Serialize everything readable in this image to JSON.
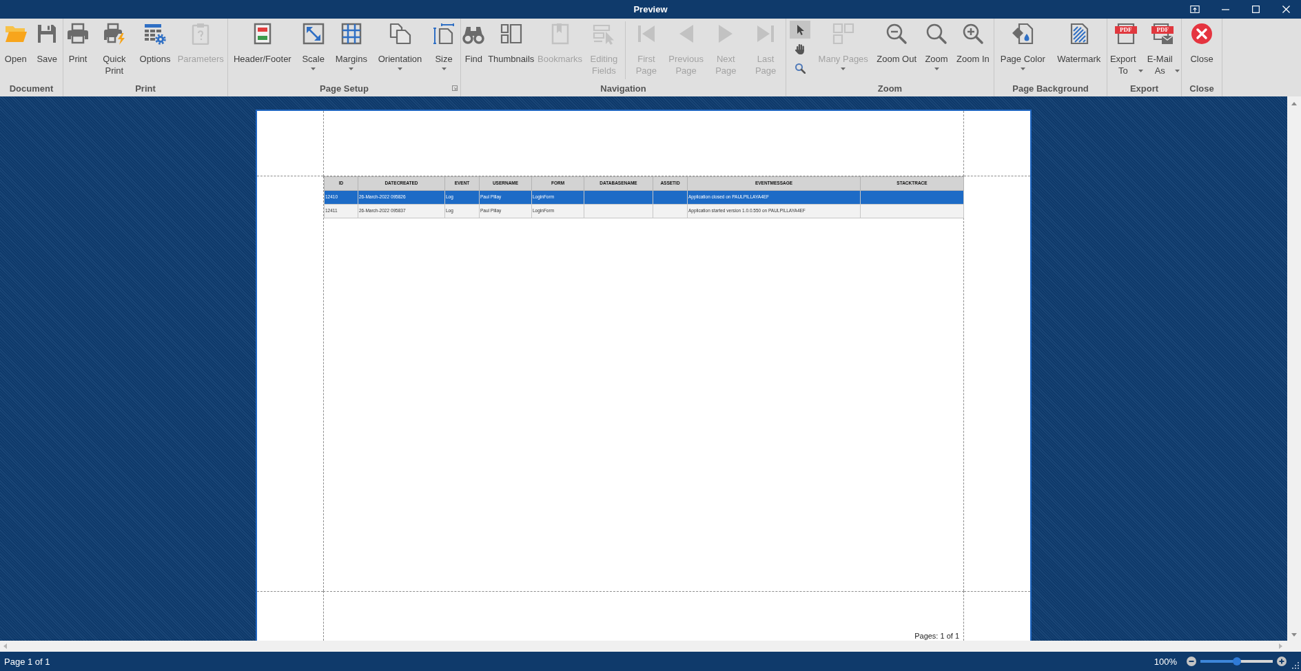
{
  "window": {
    "title": "Preview"
  },
  "ribbon": {
    "groups": [
      {
        "label": "Document",
        "dialog_launcher": false,
        "buttons": [
          {
            "label": "Open",
            "disabled": false,
            "dropdown": false
          },
          {
            "label": "Save",
            "disabled": false,
            "dropdown": false
          }
        ]
      },
      {
        "label": "Print",
        "dialog_launcher": false,
        "buttons": [
          {
            "label": "Print",
            "disabled": false,
            "dropdown": false
          },
          {
            "label": "Quick Print",
            "disabled": false,
            "dropdown": false
          },
          {
            "label": "Options",
            "disabled": false,
            "dropdown": false
          },
          {
            "label": "Parameters",
            "disabled": true,
            "dropdown": false
          }
        ]
      },
      {
        "label": "Page Setup",
        "dialog_launcher": true,
        "buttons": [
          {
            "label": "Header/Footer",
            "disabled": false,
            "dropdown": false
          },
          {
            "label": "Scale",
            "disabled": false,
            "dropdown": true
          },
          {
            "label": "Margins",
            "disabled": false,
            "dropdown": true
          },
          {
            "label": "Orientation",
            "disabled": false,
            "dropdown": true
          },
          {
            "label": "Size",
            "disabled": false,
            "dropdown": true
          }
        ]
      },
      {
        "label": "Navigation",
        "dialog_launcher": false,
        "buttons": [
          {
            "label": "Find",
            "disabled": false,
            "dropdown": false
          },
          {
            "label": "Thumbnails",
            "disabled": false,
            "dropdown": false
          },
          {
            "label": "Bookmarks",
            "disabled": true,
            "dropdown": false
          },
          {
            "label": "Editing Fields",
            "disabled": true,
            "dropdown": false
          },
          {
            "label": "First Page",
            "disabled": true,
            "dropdown": false
          },
          {
            "label": "Previous Page",
            "disabled": true,
            "dropdown": false
          },
          {
            "label": "Next Page",
            "disabled": true,
            "dropdown": false
          },
          {
            "label": "Last Page",
            "disabled": true,
            "dropdown": false
          }
        ]
      },
      {
        "label": "Zoom",
        "dialog_launcher": false,
        "tools": [
          {
            "selected": true
          },
          {
            "selected": false
          },
          {
            "selected": false
          }
        ],
        "buttons": [
          {
            "label": "Many Pages",
            "disabled": true,
            "dropdown": true
          },
          {
            "label": "Zoom Out",
            "disabled": false,
            "dropdown": false
          },
          {
            "label": "Zoom",
            "disabled": false,
            "dropdown": true
          },
          {
            "label": "Zoom In",
            "disabled": false,
            "dropdown": false
          }
        ]
      },
      {
        "label": "Page Background",
        "dialog_launcher": false,
        "buttons": [
          {
            "label": "Page Color",
            "disabled": false,
            "dropdown": true
          },
          {
            "label": "Watermark",
            "disabled": false,
            "dropdown": false
          }
        ]
      },
      {
        "label": "Export",
        "dialog_launcher": false,
        "buttons": [
          {
            "label": "Export To",
            "disabled": false,
            "dropdown": true,
            "badge": "PDF"
          },
          {
            "label": "E-Mail As",
            "disabled": false,
            "dropdown": true,
            "badge": "PDF"
          }
        ]
      },
      {
        "label": "Close",
        "dialog_launcher": false,
        "buttons": [
          {
            "label": "Close",
            "disabled": false,
            "dropdown": false
          }
        ]
      }
    ]
  },
  "report": {
    "table": {
      "columns": [
        "ID",
        "DATECREATED",
        "EVENT",
        "USERNAME",
        "FORM",
        "DATABASENAME",
        "ASSETID",
        "EVENTMESSAGE",
        "STACKTRACE"
      ],
      "rows": [
        {
          "selected": true,
          "cells": [
            "12410",
            "26-March-2022 095826",
            "Log",
            "Paul Pillay",
            "LoginForm",
            null,
            null,
            "Application closed on PAULPILLAYA4EF",
            null
          ]
        },
        {
          "selected": false,
          "cells": [
            "12411",
            "26-March-2022 095837",
            "Log",
            "Paul Pillay",
            "LoginForm",
            null,
            null,
            "Application started version 1.0.0.550 on PAULPILLAYA4EF",
            null
          ]
        }
      ]
    },
    "footer": "Pages: 1 of 1"
  },
  "status_bar": {
    "page_info": "Page 1 of 1",
    "zoom": {
      "reading": "100%",
      "level": 0.5
    }
  }
}
